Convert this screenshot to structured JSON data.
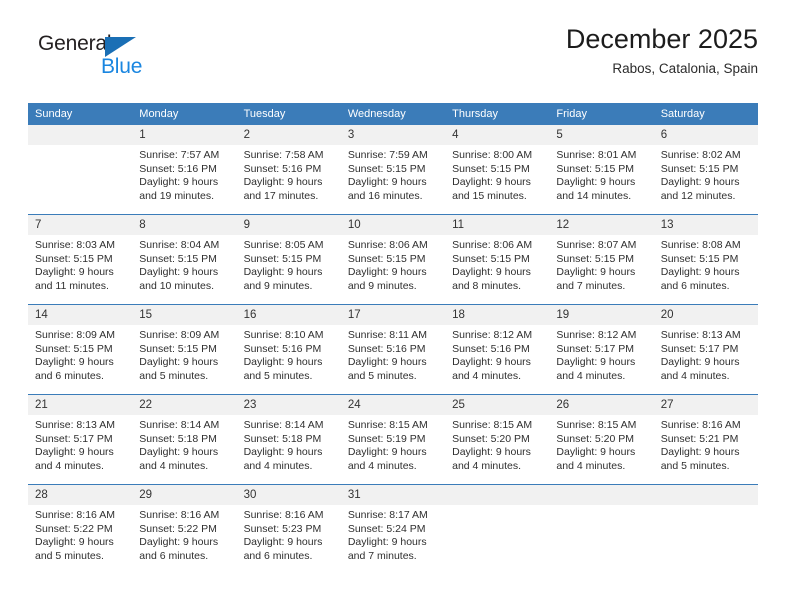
{
  "brand": {
    "name_top": "General",
    "name_bottom": "Blue",
    "triangle_color": "#1a6fb5",
    "blue_color": "#1a86e0"
  },
  "header": {
    "title": "December 2025",
    "location": "Rabos, Catalonia, Spain"
  },
  "theme": {
    "header_bg": "#3b7cb9",
    "daynum_bg": "#f1f1f1",
    "rule_color": "#3b7cb9"
  },
  "weekday_headers": [
    "Sunday",
    "Monday",
    "Tuesday",
    "Wednesday",
    "Thursday",
    "Friday",
    "Saturday"
  ],
  "weeks": [
    [
      {
        "day": "",
        "sunrise": "",
        "sunset": "",
        "daylight1": "",
        "daylight2": ""
      },
      {
        "day": "1",
        "sunrise": "Sunrise: 7:57 AM",
        "sunset": "Sunset: 5:16 PM",
        "daylight1": "Daylight: 9 hours",
        "daylight2": "and 19 minutes."
      },
      {
        "day": "2",
        "sunrise": "Sunrise: 7:58 AM",
        "sunset": "Sunset: 5:16 PM",
        "daylight1": "Daylight: 9 hours",
        "daylight2": "and 17 minutes."
      },
      {
        "day": "3",
        "sunrise": "Sunrise: 7:59 AM",
        "sunset": "Sunset: 5:15 PM",
        "daylight1": "Daylight: 9 hours",
        "daylight2": "and 16 minutes."
      },
      {
        "day": "4",
        "sunrise": "Sunrise: 8:00 AM",
        "sunset": "Sunset: 5:15 PM",
        "daylight1": "Daylight: 9 hours",
        "daylight2": "and 15 minutes."
      },
      {
        "day": "5",
        "sunrise": "Sunrise: 8:01 AM",
        "sunset": "Sunset: 5:15 PM",
        "daylight1": "Daylight: 9 hours",
        "daylight2": "and 14 minutes."
      },
      {
        "day": "6",
        "sunrise": "Sunrise: 8:02 AM",
        "sunset": "Sunset: 5:15 PM",
        "daylight1": "Daylight: 9 hours",
        "daylight2": "and 12 minutes."
      }
    ],
    [
      {
        "day": "7",
        "sunrise": "Sunrise: 8:03 AM",
        "sunset": "Sunset: 5:15 PM",
        "daylight1": "Daylight: 9 hours",
        "daylight2": "and 11 minutes."
      },
      {
        "day": "8",
        "sunrise": "Sunrise: 8:04 AM",
        "sunset": "Sunset: 5:15 PM",
        "daylight1": "Daylight: 9 hours",
        "daylight2": "and 10 minutes."
      },
      {
        "day": "9",
        "sunrise": "Sunrise: 8:05 AM",
        "sunset": "Sunset: 5:15 PM",
        "daylight1": "Daylight: 9 hours",
        "daylight2": "and 9 minutes."
      },
      {
        "day": "10",
        "sunrise": "Sunrise: 8:06 AM",
        "sunset": "Sunset: 5:15 PM",
        "daylight1": "Daylight: 9 hours",
        "daylight2": "and 9 minutes."
      },
      {
        "day": "11",
        "sunrise": "Sunrise: 8:06 AM",
        "sunset": "Sunset: 5:15 PM",
        "daylight1": "Daylight: 9 hours",
        "daylight2": "and 8 minutes."
      },
      {
        "day": "12",
        "sunrise": "Sunrise: 8:07 AM",
        "sunset": "Sunset: 5:15 PM",
        "daylight1": "Daylight: 9 hours",
        "daylight2": "and 7 minutes."
      },
      {
        "day": "13",
        "sunrise": "Sunrise: 8:08 AM",
        "sunset": "Sunset: 5:15 PM",
        "daylight1": "Daylight: 9 hours",
        "daylight2": "and 6 minutes."
      }
    ],
    [
      {
        "day": "14",
        "sunrise": "Sunrise: 8:09 AM",
        "sunset": "Sunset: 5:15 PM",
        "daylight1": "Daylight: 9 hours",
        "daylight2": "and 6 minutes."
      },
      {
        "day": "15",
        "sunrise": "Sunrise: 8:09 AM",
        "sunset": "Sunset: 5:15 PM",
        "daylight1": "Daylight: 9 hours",
        "daylight2": "and 5 minutes."
      },
      {
        "day": "16",
        "sunrise": "Sunrise: 8:10 AM",
        "sunset": "Sunset: 5:16 PM",
        "daylight1": "Daylight: 9 hours",
        "daylight2": "and 5 minutes."
      },
      {
        "day": "17",
        "sunrise": "Sunrise: 8:11 AM",
        "sunset": "Sunset: 5:16 PM",
        "daylight1": "Daylight: 9 hours",
        "daylight2": "and 5 minutes."
      },
      {
        "day": "18",
        "sunrise": "Sunrise: 8:12 AM",
        "sunset": "Sunset: 5:16 PM",
        "daylight1": "Daylight: 9 hours",
        "daylight2": "and 4 minutes."
      },
      {
        "day": "19",
        "sunrise": "Sunrise: 8:12 AM",
        "sunset": "Sunset: 5:17 PM",
        "daylight1": "Daylight: 9 hours",
        "daylight2": "and 4 minutes."
      },
      {
        "day": "20",
        "sunrise": "Sunrise: 8:13 AM",
        "sunset": "Sunset: 5:17 PM",
        "daylight1": "Daylight: 9 hours",
        "daylight2": "and 4 minutes."
      }
    ],
    [
      {
        "day": "21",
        "sunrise": "Sunrise: 8:13 AM",
        "sunset": "Sunset: 5:17 PM",
        "daylight1": "Daylight: 9 hours",
        "daylight2": "and 4 minutes."
      },
      {
        "day": "22",
        "sunrise": "Sunrise: 8:14 AM",
        "sunset": "Sunset: 5:18 PM",
        "daylight1": "Daylight: 9 hours",
        "daylight2": "and 4 minutes."
      },
      {
        "day": "23",
        "sunrise": "Sunrise: 8:14 AM",
        "sunset": "Sunset: 5:18 PM",
        "daylight1": "Daylight: 9 hours",
        "daylight2": "and 4 minutes."
      },
      {
        "day": "24",
        "sunrise": "Sunrise: 8:15 AM",
        "sunset": "Sunset: 5:19 PM",
        "daylight1": "Daylight: 9 hours",
        "daylight2": "and 4 minutes."
      },
      {
        "day": "25",
        "sunrise": "Sunrise: 8:15 AM",
        "sunset": "Sunset: 5:20 PM",
        "daylight1": "Daylight: 9 hours",
        "daylight2": "and 4 minutes."
      },
      {
        "day": "26",
        "sunrise": "Sunrise: 8:15 AM",
        "sunset": "Sunset: 5:20 PM",
        "daylight1": "Daylight: 9 hours",
        "daylight2": "and 4 minutes."
      },
      {
        "day": "27",
        "sunrise": "Sunrise: 8:16 AM",
        "sunset": "Sunset: 5:21 PM",
        "daylight1": "Daylight: 9 hours",
        "daylight2": "and 5 minutes."
      }
    ],
    [
      {
        "day": "28",
        "sunrise": "Sunrise: 8:16 AM",
        "sunset": "Sunset: 5:22 PM",
        "daylight1": "Daylight: 9 hours",
        "daylight2": "and 5 minutes."
      },
      {
        "day": "29",
        "sunrise": "Sunrise: 8:16 AM",
        "sunset": "Sunset: 5:22 PM",
        "daylight1": "Daylight: 9 hours",
        "daylight2": "and 6 minutes."
      },
      {
        "day": "30",
        "sunrise": "Sunrise: 8:16 AM",
        "sunset": "Sunset: 5:23 PM",
        "daylight1": "Daylight: 9 hours",
        "daylight2": "and 6 minutes."
      },
      {
        "day": "31",
        "sunrise": "Sunrise: 8:17 AM",
        "sunset": "Sunset: 5:24 PM",
        "daylight1": "Daylight: 9 hours",
        "daylight2": "and 7 minutes."
      },
      {
        "day": "",
        "sunrise": "",
        "sunset": "",
        "daylight1": "",
        "daylight2": ""
      },
      {
        "day": "",
        "sunrise": "",
        "sunset": "",
        "daylight1": "",
        "daylight2": ""
      },
      {
        "day": "",
        "sunrise": "",
        "sunset": "",
        "daylight1": "",
        "daylight2": ""
      }
    ]
  ]
}
